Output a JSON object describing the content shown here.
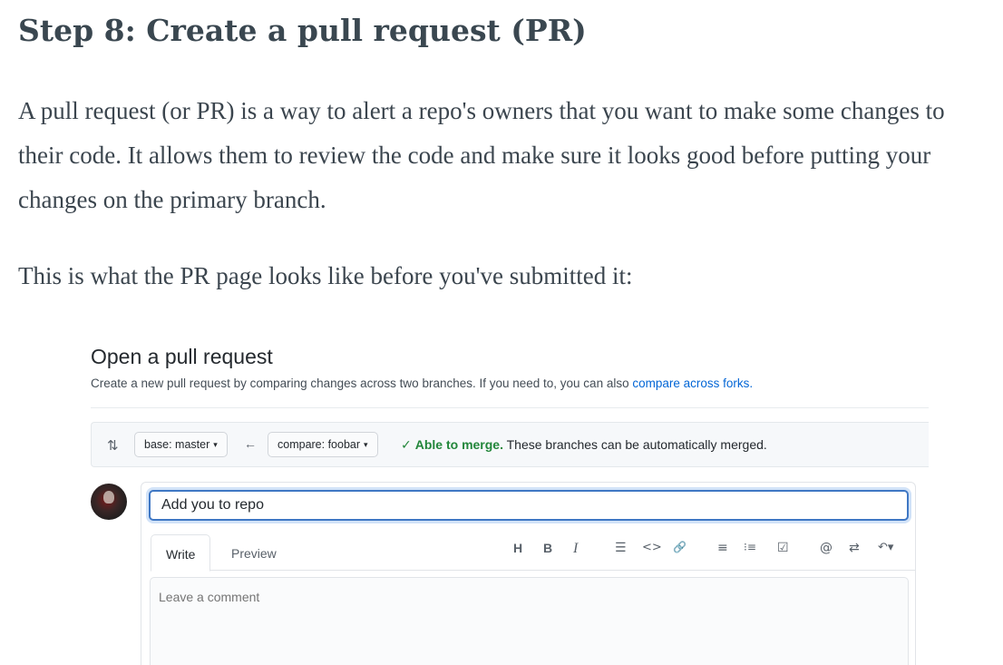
{
  "article": {
    "heading": "Step 8: Create a pull request (PR)",
    "paragraph1": "A pull request (or PR) is a way to alert a repo's owners that you want to make some changes to their code. It allows them to review the code and make sure it looks good before putting your changes on the primary branch.",
    "paragraph2": "This is what the PR page looks like before you've submitted it:"
  },
  "pr_page": {
    "title": "Open a pull request",
    "subtitle": "Create a new pull request by comparing changes across two branches. If you need to, you can also ",
    "subtitle_link": "compare across forks.",
    "base_label": "base: master",
    "compare_label": "compare: foobar",
    "merge_status": "Able to merge.",
    "merge_note": " These branches can be automatically merged.",
    "title_value": "Add you to repo",
    "tabs": {
      "write": "Write",
      "preview": "Preview"
    },
    "comment_placeholder": "Leave a comment",
    "toolbar": {
      "header": "H",
      "bold": "B",
      "italic": "I",
      "quote": "☰",
      "code": "<>",
      "link": "🔗",
      "bulleted_list": "≡",
      "numbered_list": "⁝≡",
      "task_list": "☑",
      "mention": "@",
      "reference": "⇄",
      "reply": "↶▾"
    },
    "icons": {
      "compare_icon": "⇅",
      "arrow": "←",
      "check": "✓",
      "caret": "▾"
    },
    "colors": {
      "link": "#0366d6",
      "success": "#22863a",
      "focus": "#3f77c4"
    }
  }
}
